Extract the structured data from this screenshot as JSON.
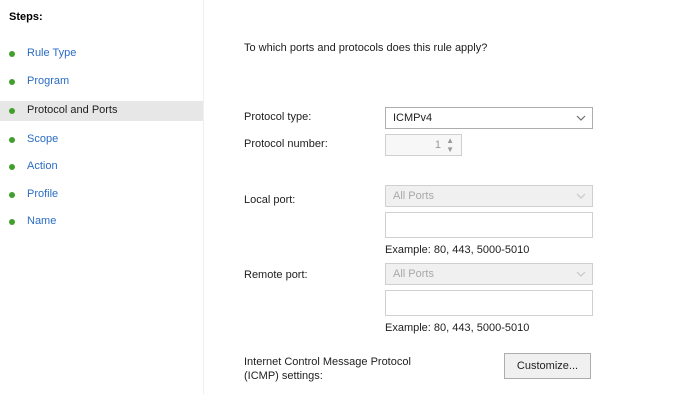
{
  "sidebar": {
    "title": "Steps:",
    "items": [
      {
        "label": "Rule Type"
      },
      {
        "label": "Program"
      },
      {
        "label": "Protocol and Ports"
      },
      {
        "label": "Scope"
      },
      {
        "label": "Action"
      },
      {
        "label": "Profile"
      },
      {
        "label": "Name"
      }
    ],
    "active_index": 2
  },
  "main": {
    "question": "To which ports and protocols does this rule apply?",
    "protocol_type": {
      "label": "Protocol type:",
      "value": "ICMPv4"
    },
    "protocol_number": {
      "label": "Protocol number:",
      "value": "1"
    },
    "local_port": {
      "label": "Local port:",
      "value": "All Ports",
      "text": "",
      "example": "Example: 80, 443, 5000-5010"
    },
    "remote_port": {
      "label": "Remote port:",
      "value": "All Ports",
      "text": "",
      "example": "Example: 80, 443, 5000-5010"
    },
    "icmp": {
      "label_line1": "Internet Control Message Protocol",
      "label_line2": "(ICMP) settings:",
      "button": "Customize..."
    }
  },
  "colors": {
    "bullet": "#41a02c",
    "link": "#2b6cc4",
    "selected_bg": "#e7e7e7"
  }
}
